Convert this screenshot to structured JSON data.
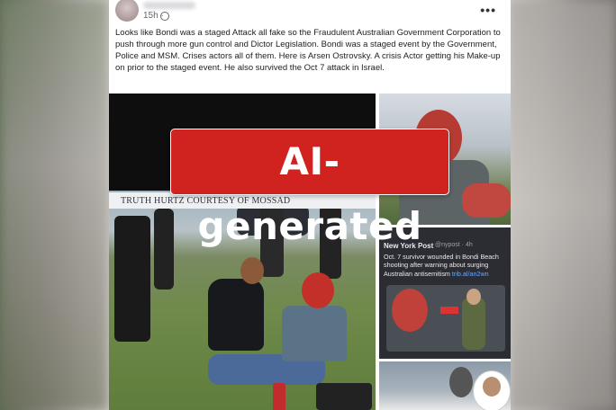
{
  "post": {
    "timestamp": "15h ·",
    "more_label": "•••",
    "text": "Looks like Bondi was a staged Attack all fake so the Fraudulent Australian Government Corporation to push through more gun control and Dictor Legislation. Bondi was a staged event by the Government, Police and MSM. Crises actors all of them. Here is Arsen Ostrovsky. A crisis Actor getting his Make-up on prior to the staged event. He also survived the Oct 7 attack in Israel."
  },
  "main_image": {
    "watermark": "TRUTH HURTZ COURTESY OF MOSSAD"
  },
  "tweet": {
    "source": "New York Post",
    "handle": "@nypost · 4h",
    "text": "Oct. 7 survivor wounded in Bondi Beach shooting after warning about surging Australian antisemitism",
    "link": "trib.al/an2wn"
  },
  "overlay": {
    "label": "AI-generated",
    "color": "#d0221e"
  }
}
